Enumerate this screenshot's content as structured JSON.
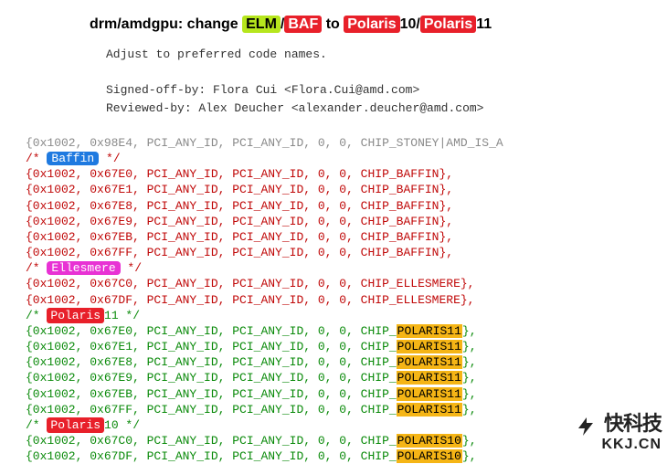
{
  "title": {
    "prefix": "drm/amdgpu: change ",
    "elm": "ELM",
    "sep1": "/",
    "baf": "BAF",
    "mid": " to ",
    "polA": "Polaris",
    "polAnum": "10/",
    "polB": "Polaris",
    "polBnum": "11"
  },
  "meta": {
    "desc": "Adjust to preferred code names.",
    "signed": "Signed-off-by: Flora Cui <Flora.Cui@amd.com>",
    "reviewed": "Reviewed-by: Alex Deucher <alexander.deucher@amd.com>"
  },
  "lines": [
    {
      "cls": "grey",
      "plain": "{0x1002, 0x98E4, PCI_ANY_ID, PCI_ANY_ID, 0, 0, CHIP_STONEY|AMD_IS_A"
    },
    {
      "cls": "red",
      "comment_open": "/* ",
      "pill": "Baffin",
      "pill_cls": "hl-blue",
      "comment_close": " */"
    },
    {
      "cls": "red",
      "plain": "{0x1002, 0x67E0, PCI_ANY_ID, PCI_ANY_ID, 0, 0, CHIP_BAFFIN},"
    },
    {
      "cls": "red",
      "plain": "{0x1002, 0x67E1, PCI_ANY_ID, PCI_ANY_ID, 0, 0, CHIP_BAFFIN},"
    },
    {
      "cls": "red",
      "plain": "{0x1002, 0x67E8, PCI_ANY_ID, PCI_ANY_ID, 0, 0, CHIP_BAFFIN},"
    },
    {
      "cls": "red",
      "plain": "{0x1002, 0x67E9, PCI_ANY_ID, PCI_ANY_ID, 0, 0, CHIP_BAFFIN},"
    },
    {
      "cls": "red",
      "plain": "{0x1002, 0x67EB, PCI_ANY_ID, PCI_ANY_ID, 0, 0, CHIP_BAFFIN},"
    },
    {
      "cls": "red",
      "plain": "{0x1002, 0x67FF, PCI_ANY_ID, PCI_ANY_ID, 0, 0, CHIP_BAFFIN},"
    },
    {
      "cls": "red",
      "comment_open": "/* ",
      "pill": "Ellesmere",
      "pill_cls": "hl-magenta",
      "comment_close": " */"
    },
    {
      "cls": "red",
      "plain": "{0x1002, 0x67C0, PCI_ANY_ID, PCI_ANY_ID, 0, 0, CHIP_ELLESMERE},"
    },
    {
      "cls": "red",
      "plain": "{0x1002, 0x67DF, PCI_ANY_ID, PCI_ANY_ID, 0, 0, CHIP_ELLESMERE},"
    },
    {
      "cls": "green",
      "comment_open": "/* ",
      "pill": "Polaris",
      "pill_cls": "hl-red",
      "after_pill": "11",
      "comment_close": " */"
    },
    {
      "cls": "green",
      "pre": "{0x1002, 0x67E0, PCI_ANY_ID, PCI_ANY_ID, 0, 0, CHIP_",
      "orange": "POLARIS11",
      "post": "},"
    },
    {
      "cls": "green",
      "pre": "{0x1002, 0x67E1, PCI_ANY_ID, PCI_ANY_ID, 0, 0, CHIP_",
      "orange": "POLARIS11",
      "post": "},"
    },
    {
      "cls": "green",
      "pre": "{0x1002, 0x67E8, PCI_ANY_ID, PCI_ANY_ID, 0, 0, CHIP_",
      "orange": "POLARIS11",
      "post": "},"
    },
    {
      "cls": "green",
      "pre": "{0x1002, 0x67E9, PCI_ANY_ID, PCI_ANY_ID, 0, 0, CHIP_",
      "orange": "POLARIS11",
      "post": "},"
    },
    {
      "cls": "green",
      "pre": "{0x1002, 0x67EB, PCI_ANY_ID, PCI_ANY_ID, 0, 0, CHIP_",
      "orange": "POLARIS11",
      "post": "},"
    },
    {
      "cls": "green",
      "pre": "{0x1002, 0x67FF, PCI_ANY_ID, PCI_ANY_ID, 0, 0, CHIP_",
      "orange": "POLARIS11",
      "post": "},"
    },
    {
      "cls": "green",
      "comment_open": "/* ",
      "pill": "Polaris",
      "pill_cls": "hl-red",
      "after_pill": "10",
      "comment_close": " */"
    },
    {
      "cls": "green",
      "pre": "{0x1002, 0x67C0, PCI_ANY_ID, PCI_ANY_ID, 0, 0, CHIP_",
      "orange": "POLARIS10",
      "post": "},"
    },
    {
      "cls": "green",
      "pre": "{0x1002, 0x67DF, PCI_ANY_ID, PCI_ANY_ID, 0, 0, CHIP_",
      "orange": "POLARIS10",
      "post": "},"
    }
  ],
  "watermark": {
    "caption": "快科技",
    "url": "KKJ.CN"
  }
}
